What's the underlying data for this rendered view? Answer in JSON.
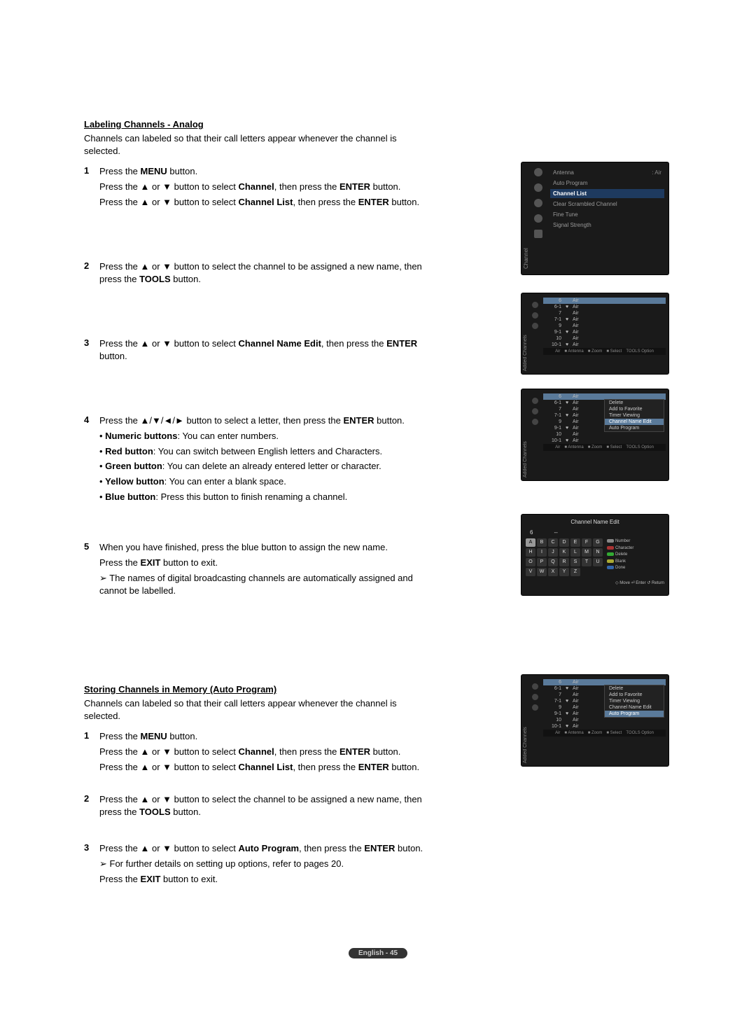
{
  "section1": {
    "heading": "Labeling Channels - Analog",
    "intro": "Channels can labeled so that their call letters appear whenever the channel is selected."
  },
  "s1step1": {
    "num": "1",
    "l1a": "Press the ",
    "l1b": "MENU",
    "l1c": " button.",
    "l2a": "Press the ▲ or ▼ button to select ",
    "l2b": "Channel",
    "l2c": ", then press the ",
    "l2d": "ENTER",
    "l2e": " button.",
    "l3a": "Press the ▲ or ▼ button to select ",
    "l3b": "Channel List",
    "l3c": ", then press the ",
    "l3d": "ENTER",
    "l3e": " button."
  },
  "s1step2": {
    "num": "2",
    "l1": "Press the ▲ or ▼ button to select the channel to be assigned a new name, then press the ",
    "l1b": "TOOLS",
    "l1c": " button."
  },
  "s1step3": {
    "num": "3",
    "l1a": "Press the ▲ or ▼ button to select ",
    "l1b": "Channel Name Edit",
    "l1c": ", then press the ",
    "l1d": "ENTER",
    "l1e": " button."
  },
  "s1step4": {
    "num": "4",
    "l1a": "Press the ▲/▼/◄/► button to select a letter, then press the ",
    "l1b": "ENTER",
    "l1c": " button.",
    "b1a": "Numeric buttons",
    "b1b": ": You can enter numbers.",
    "b2a": "Red button",
    "b2b": ": You can switch between English letters and Characters.",
    "b3a": "Green button",
    "b3b": ": You can delete an already entered letter or character.",
    "b4a": "Yellow button",
    "b4b": ": You can enter a blank space.",
    "b5a": "Blue button",
    "b5b": ": Press this button to finish renaming a channel."
  },
  "s1step5": {
    "num": "5",
    "l1": "When you have finished, press the blue button to assign the new name.",
    "l2a": "Press the ",
    "l2b": "EXIT",
    "l2c": " button to exit.",
    "note": "The names of digital broadcasting channels are automatically assigned and cannot be labelled."
  },
  "section2": {
    "heading": "Storing Channels in Memory (Auto Program)",
    "intro": "Channels can labeled so that their call letters appear whenever the channel is selected."
  },
  "s2step1": {
    "num": "1",
    "l1a": "Press the ",
    "l1b": "MENU",
    "l1c": " button.",
    "l2a": "Press the ▲ or ▼ button to select ",
    "l2b": "Channel",
    "l2c": ", then press the ",
    "l2d": "ENTER",
    "l2e": " button.",
    "l3a": "Press the ▲ or ▼ button to select ",
    "l3b": "Channel List",
    "l3c": ", then press the ",
    "l3d": "ENTER",
    "l3e": " button."
  },
  "s2step2": {
    "num": "2",
    "l1": "Press the ▲ or ▼ button to select the channel to be assigned a new name, then press the ",
    "l1b": "TOOLS",
    "l1c": " button."
  },
  "s2step3": {
    "num": "3",
    "l1a": "Press the ▲ or ▼ button to select ",
    "l1b": "Auto Program",
    "l1c": ", then press the ",
    "l1d": "ENTER",
    "l1e": " buton.",
    "note": "For further details on setting up options, refer to pages 20.",
    "l2a": "Press the ",
    "l2b": "EXIT",
    "l2c": " button to exit."
  },
  "footer": "English - 45",
  "ss1": {
    "side": "Channel",
    "antenna_label": "Antenna",
    "antenna_value": ": Air",
    "auto_program": "Auto Program",
    "channel_list": "Channel List",
    "clear": "Clear Scrambled Channel",
    "fine_tune": "Fine Tune",
    "signal": "Signal Strength"
  },
  "chlist": {
    "side": "Added Channels",
    "rows": [
      {
        "n": "6",
        "t": "Air",
        "hi": true
      },
      {
        "n": "6-1",
        "m": "♥",
        "t": "Air"
      },
      {
        "n": "7",
        "t": "Air"
      },
      {
        "n": "7-1",
        "m": "♥",
        "t": "Air"
      },
      {
        "n": "9",
        "t": "Air"
      },
      {
        "n": "9-1",
        "m": "♥",
        "t": "Air"
      },
      {
        "n": "10",
        "t": "Air"
      },
      {
        "n": "10-1",
        "m": "♥",
        "t": "Air"
      }
    ],
    "foot": [
      "Air",
      "■ Antenna",
      "■ Zoom",
      "■ Select",
      "TOOLS Option"
    ]
  },
  "popup3": [
    "Delete",
    "Add to Favorite",
    "Timer Viewing",
    "Channel Name Edit",
    "Auto Program"
  ],
  "popup3_hi": 3,
  "popup5": [
    "Delete",
    "Add to Favorite",
    "Timer Viewing",
    "Channel Name Edit",
    "Auto Program"
  ],
  "popup5_hi": 4,
  "ss4": {
    "title": "Channel Name Edit",
    "ch": "6",
    "letters": [
      "A",
      "B",
      "C",
      "D",
      "E",
      "F",
      "G",
      "H",
      "I",
      "J",
      "K",
      "L",
      "M",
      "N",
      "O",
      "P",
      "Q",
      "R",
      "S",
      "T",
      "U",
      "V",
      "W",
      "X",
      "Y",
      "Z"
    ],
    "legend": [
      {
        "c": "#888",
        "t": "Number"
      },
      {
        "c": "#a33",
        "t": "Character"
      },
      {
        "c": "#3a3",
        "t": "Delete"
      },
      {
        "c": "#aa3",
        "t": "Blank"
      },
      {
        "c": "#36a",
        "t": "Done"
      }
    ],
    "foot": "◇ Move   ⏎ Enter   ↺ Return"
  }
}
